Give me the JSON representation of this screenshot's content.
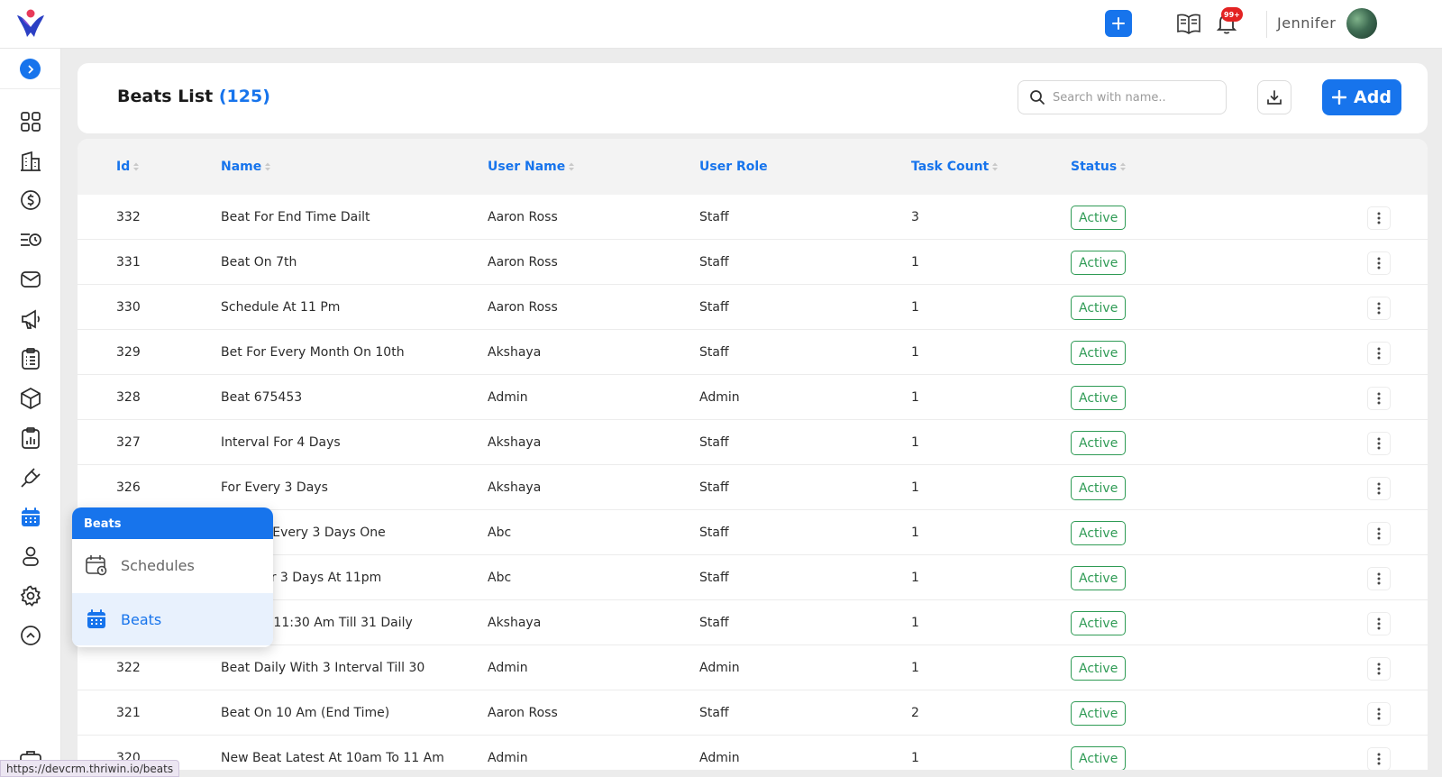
{
  "topbar": {
    "user_name": "Jennifer",
    "notification_badge": "99+"
  },
  "header": {
    "title": "Beats List",
    "count": "(125)",
    "search_placeholder": "Search with name..",
    "add_label": "Add"
  },
  "table": {
    "columns": [
      "Id",
      "Name",
      "User Name",
      "User Role",
      "Task Count",
      "Status"
    ],
    "rows": [
      {
        "id": "332",
        "name": "Beat For End Time Dailt",
        "user": "Aaron Ross",
        "role": "Staff",
        "tasks": "3",
        "status": "Active"
      },
      {
        "id": "331",
        "name": "Beat On 7th",
        "user": "Aaron Ross",
        "role": "Staff",
        "tasks": "1",
        "status": "Active"
      },
      {
        "id": "330",
        "name": "Schedule At 11 Pm",
        "user": "Aaron Ross",
        "role": "Staff",
        "tasks": "1",
        "status": "Active"
      },
      {
        "id": "329",
        "name": "Bet For Every Month On 10th",
        "user": "Akshaya",
        "role": "Staff",
        "tasks": "1",
        "status": "Active"
      },
      {
        "id": "328",
        "name": "Beat 675453",
        "user": "Admin",
        "role": "Admin",
        "tasks": "1",
        "status": "Active"
      },
      {
        "id": "327",
        "name": "Interval For 4 Days",
        "user": "Akshaya",
        "role": "Staff",
        "tasks": "1",
        "status": "Active"
      },
      {
        "id": "326",
        "name": "For Every 3 Days",
        "user": "Akshaya",
        "role": "Staff",
        "tasks": "1",
        "status": "Active"
      },
      {
        "id": "",
        "name": "rval For Every 3 Days One",
        "user": "Abc",
        "role": "Staff",
        "tasks": "1",
        "status": "Active"
      },
      {
        "id": "",
        "name": "erval For 3 Days At 11pm",
        "user": "Abc",
        "role": "Staff",
        "tasks": "1",
        "status": "Active"
      },
      {
        "id": "",
        "name": "om 11 - 11:30 Am Till 31 Daily",
        "user": "Akshaya",
        "role": "Staff",
        "tasks": "1",
        "status": "Active"
      },
      {
        "id": "322",
        "name": "Beat Daily With 3 Interval Till 30",
        "user": "Admin",
        "role": "Admin",
        "tasks": "1",
        "status": "Active"
      },
      {
        "id": "321",
        "name": "Beat On 10 Am (End Time)",
        "user": "Aaron Ross",
        "role": "Staff",
        "tasks": "2",
        "status": "Active"
      },
      {
        "id": "320",
        "name": "New Beat Latest At 10am To 11 Am",
        "user": "Admin",
        "role": "Admin",
        "tasks": "1",
        "status": "Active"
      }
    ]
  },
  "flyout": {
    "header": "Beats",
    "items": [
      "Schedules",
      "Beats"
    ]
  },
  "status_url": "https://devcrm.thriwin.io/beats",
  "colors": {
    "accent": "#1774ec",
    "active_green": "#2f9b55",
    "badge_red": "#e32323"
  }
}
